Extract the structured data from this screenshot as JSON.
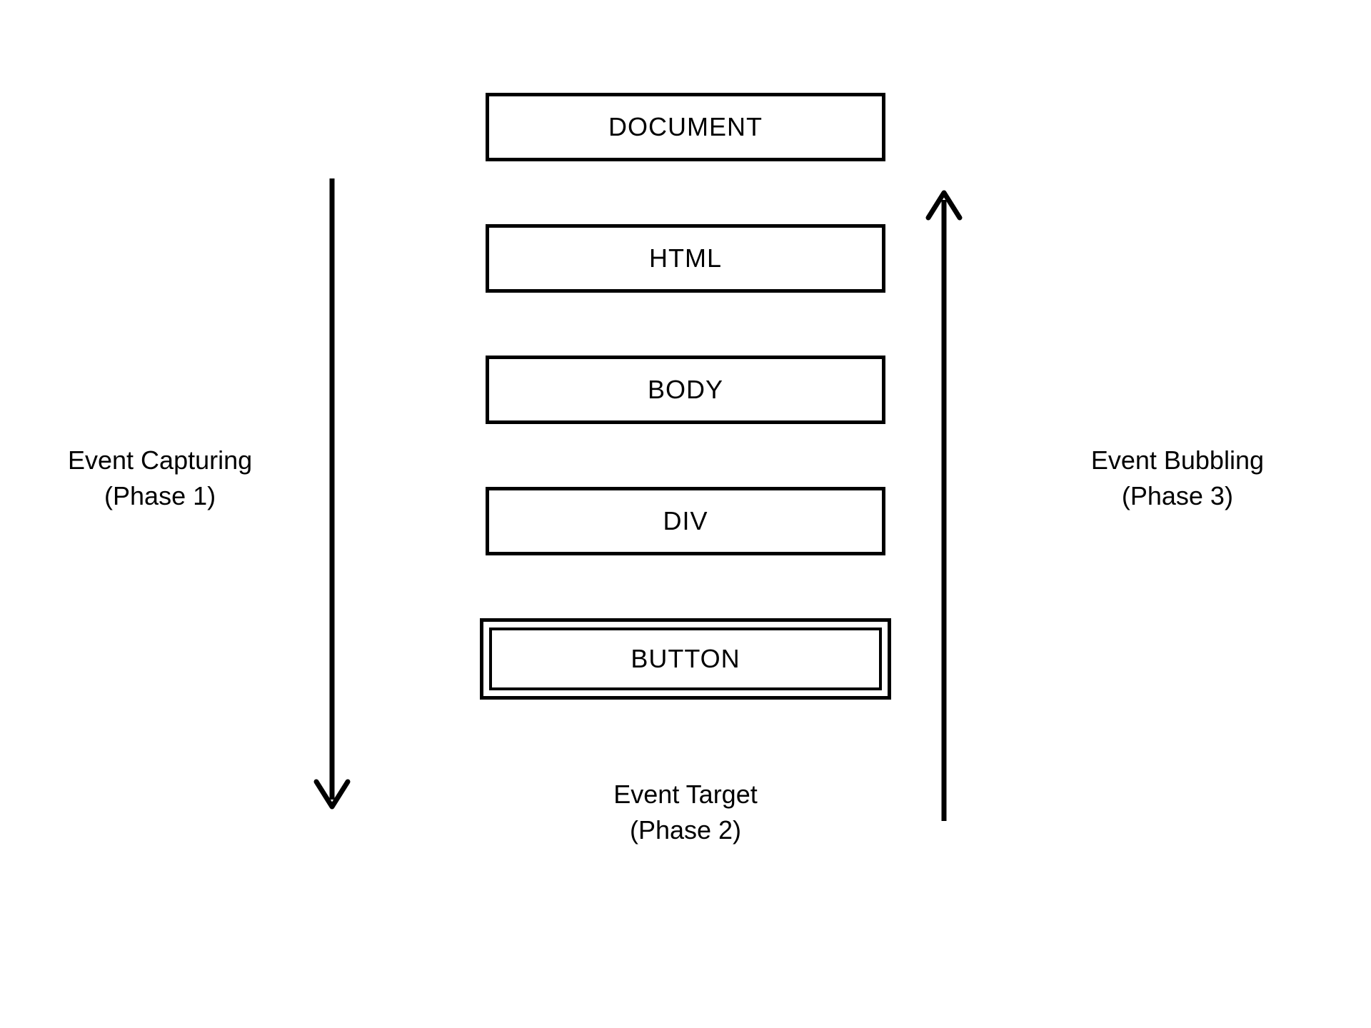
{
  "leftLabel": {
    "line1": "Event Capturing",
    "line2": "(Phase 1)"
  },
  "rightLabel": {
    "line1": "Event Bubbling",
    "line2": "(Phase 3)"
  },
  "bottomLabel": {
    "line1": "Event Target",
    "line2": "(Phase 2)"
  },
  "boxes": [
    "DOCUMENT",
    "HTML",
    "BODY",
    "DIV",
    "BUTTON"
  ]
}
